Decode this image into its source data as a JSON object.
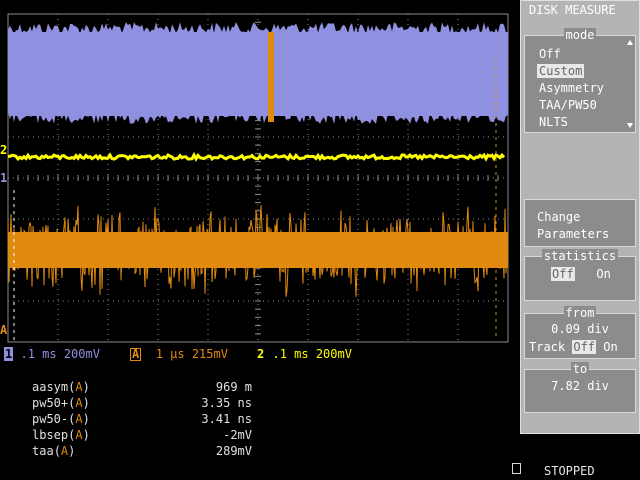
{
  "menu": {
    "title": "DISK MEASURE",
    "mode": {
      "title": "mode",
      "options": [
        "Off",
        "Custom",
        "Asymmetry",
        "TAA/PW50",
        "NLTS"
      ],
      "selected": "Custom"
    },
    "change_parameters": {
      "line1": "Change",
      "line2": "Parameters"
    },
    "statistics": {
      "title": "statistics",
      "off": "Off",
      "on": "On",
      "selected": "Off"
    },
    "from": {
      "title": "from",
      "value": "0.09 div",
      "track_label": "Track",
      "off": "Off",
      "on": "On",
      "selected": "Off"
    },
    "to": {
      "title": "to",
      "value": "7.82 div"
    }
  },
  "traces": {
    "trace1": {
      "label": "1",
      "color": "#9090e0"
    },
    "trace2": {
      "label": "2",
      "color": "#ffff00"
    },
    "traceA": {
      "label": "A",
      "color": "#e08a10"
    }
  },
  "channel_info": {
    "ch1": {
      "badge": "1",
      "timebase": ".1 ms",
      "volts": "200mV"
    },
    "chA": {
      "badge": "A",
      "timebase": "1 μs",
      "volts": "215mV"
    },
    "ch2": {
      "badge": "2",
      "timebase": ".1 ms",
      "volts": "200mV"
    }
  },
  "measurements": [
    {
      "name": "aasym",
      "source": "A",
      "value": "969 m"
    },
    {
      "name": "pw50+",
      "source": "A",
      "value": "3.35 ns"
    },
    {
      "name": "pw50-",
      "source": "A",
      "value": "3.41 ns"
    },
    {
      "name": "lbsep",
      "source": "A",
      "value": "-2mV"
    },
    {
      "name": "taa",
      "source": "A",
      "value": "289mV"
    }
  ],
  "status": {
    "run_state": "STOPPED"
  },
  "colors": {
    "graticule": "#8a8a8a",
    "blue_trace": "#9090e0",
    "yellow_trace": "#ffff00",
    "orange_trace": "#e08a10",
    "menu_bg": "#b4b4b4",
    "button_bg": "#8c8c8c"
  }
}
